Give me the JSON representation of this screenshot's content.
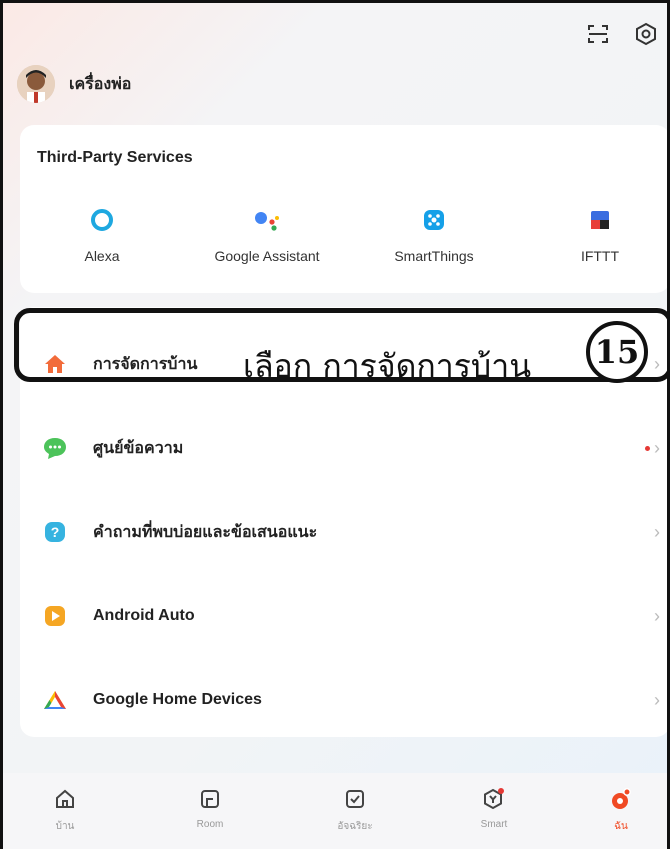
{
  "profile": {
    "name": "เครื่องพ่อ",
    "avatar_icon": "avatar"
  },
  "top_icons": [
    "scan-icon",
    "settings-icon"
  ],
  "third_party": {
    "title": "Third-Party Services",
    "services": [
      {
        "label": "Alexa",
        "icon": "alexa-icon"
      },
      {
        "label": "Google Assistant",
        "icon": "google-assistant-icon"
      },
      {
        "label": "SmartThings",
        "icon": "smartthings-icon"
      },
      {
        "label": "IFTTT",
        "icon": "ifttt-icon"
      }
    ]
  },
  "menu": [
    {
      "label": "การจัดการบ้าน",
      "icon": "home-icon",
      "color": "#f26b3a"
    },
    {
      "label": "ศูนย์ข้อความ",
      "icon": "message-icon",
      "color": "#4cc35a",
      "dot": true
    },
    {
      "label": "คำถามที่พบบ่อยและข้อเสนอแนะ",
      "icon": "help-icon",
      "color": "#36b3e0"
    },
    {
      "label": "Android Auto",
      "icon": "android-auto-icon",
      "color": "#f5a623"
    },
    {
      "label": "Google Home Devices",
      "icon": "google-home-icon"
    }
  ],
  "annotation": {
    "text": "เลือก การจัดการบ้าน",
    "number": "15"
  },
  "bottom_nav": [
    {
      "label": "บ้าน",
      "icon": "home-nav-icon"
    },
    {
      "label": "Room",
      "icon": "room-nav-icon"
    },
    {
      "label": "อัจฉริยะ",
      "icon": "smart-scene-nav-icon"
    },
    {
      "label": "Smart",
      "icon": "smart-nav-icon"
    },
    {
      "label": "ฉัน",
      "icon": "me-nav-icon",
      "active": true
    }
  ],
  "colors": {
    "accent": "#f04a24",
    "background": "#f2f4f6",
    "card": "#ffffff"
  }
}
